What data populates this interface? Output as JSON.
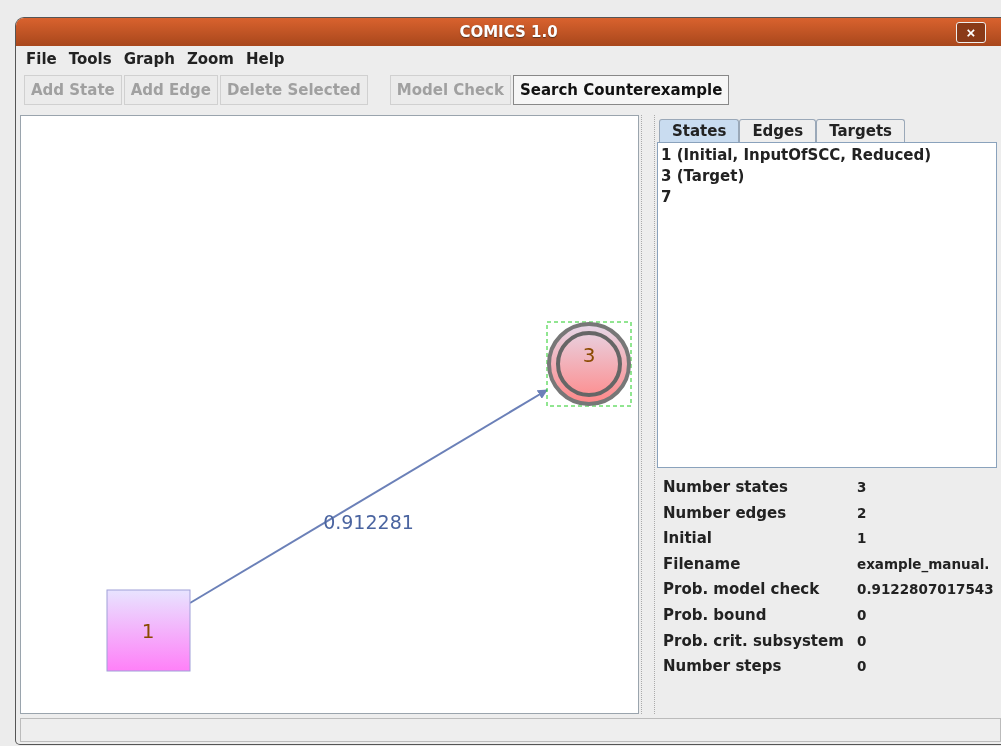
{
  "window": {
    "title": "COMICS 1.0",
    "close": "×"
  },
  "menu": [
    "File",
    "Tools",
    "Graph",
    "Zoom",
    "Help"
  ],
  "toolbar": [
    [
      {
        "label": "Add State",
        "disabled": true
      },
      {
        "label": "Add Edge",
        "disabled": true
      },
      {
        "label": "Delete Selected",
        "disabled": true
      }
    ],
    [
      {
        "label": "Model Check",
        "disabled": true
      },
      {
        "label": "Search Counterexample",
        "disabled": false
      }
    ]
  ],
  "graph": {
    "nodes": [
      {
        "label": "1",
        "kind": "box",
        "selected": false
      },
      {
        "label": "3",
        "kind": "target",
        "selected": true
      }
    ],
    "edges": [
      {
        "label": "0.912281"
      }
    ]
  },
  "tabs": [
    {
      "label": "States",
      "selected": true
    },
    {
      "label": "Edges",
      "selected": false
    },
    {
      "label": "Targets",
      "selected": false
    }
  ],
  "states": [
    "1 (Initial, InputOfSCC, Reduced)",
    "3 (Target)",
    "7"
  ],
  "properties": [
    {
      "name": "Number states",
      "value": "3"
    },
    {
      "name": "Number edges",
      "value": "2"
    },
    {
      "name": "Initial",
      "value": "1"
    },
    {
      "name": "Filename",
      "value": "example_manual."
    },
    {
      "name": "Prob. model check",
      "value": "0.9122807017543"
    },
    {
      "name": "Prob. bound",
      "value": "0"
    },
    {
      "name": "Prob. crit. subsystem",
      "value": "0"
    },
    {
      "name": "Number steps",
      "value": "0"
    }
  ]
}
